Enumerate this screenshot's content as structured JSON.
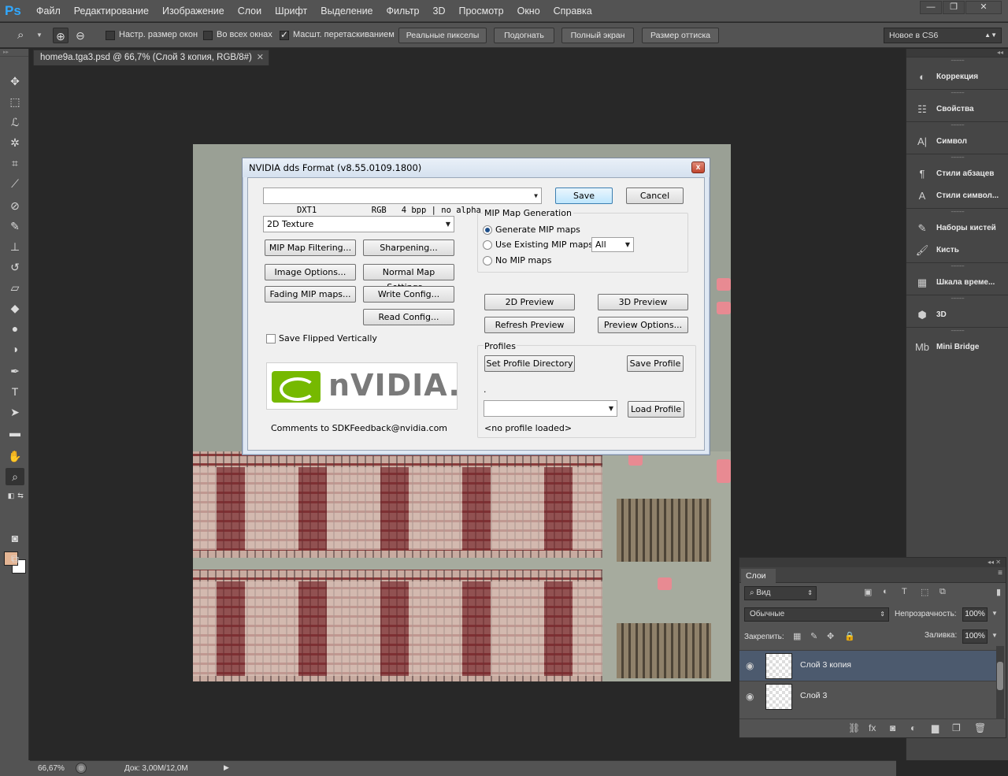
{
  "app": {
    "logo": "Ps",
    "menu": [
      "Файл",
      "Редактирование",
      "Изображение",
      "Слои",
      "Шрифт",
      "Выделение",
      "Фильтр",
      "3D",
      "Просмотр",
      "Окно",
      "Справка"
    ],
    "window_controls": {
      "minimize": "—",
      "restore": "❐",
      "close": "✕"
    }
  },
  "options_bar": {
    "resize_windows": {
      "label": "Настр. размер окон",
      "checked": false
    },
    "all_windows": {
      "label": "Во всех окнах",
      "checked": false
    },
    "scrubby_zoom": {
      "label": "Масшт. перетаскиванием",
      "checked": true
    },
    "buttons": [
      "Реальные пикселы",
      "Подогнать",
      "Полный экран",
      "Размер оттиска"
    ],
    "workspace": "Новое в CS6"
  },
  "document": {
    "tab_title": "home9a.tga3.psd @ 66,7% (Слой 3 копия, RGB/8#)",
    "tab_close": "✕"
  },
  "dialog": {
    "title": "NVIDIA dds Format (v8.55.0109.1800)",
    "close": "x",
    "format": "DXT1           RGB   4 bpp | no alpha",
    "save": "Save",
    "cancel": "Cancel",
    "texture_type": "2D Texture",
    "left_buttons": [
      "MIP Map Filtering...",
      "Sharpening...",
      "Image Options...",
      "Normal Map Settings...",
      "Fading MIP maps...",
      "Write Config...",
      "Read Config..."
    ],
    "save_flipped": {
      "label": "Save Flipped Vertically",
      "checked": false
    },
    "logo_word": "nVIDIA.",
    "feedback": "Comments to SDKFeedback@nvidia.com",
    "mip_group": {
      "title": "MIP Map Generation",
      "options": [
        "Generate MIP maps",
        "Use Existing MIP maps",
        "No MIP maps"
      ],
      "selected": "Generate MIP maps",
      "existing_count": "All"
    },
    "preview_buttons": [
      "2D Preview",
      "3D Preview",
      "Refresh Preview",
      "Preview Options..."
    ],
    "profiles": {
      "title": "Profiles",
      "set_dir": "Set Profile Directory",
      "save": "Save Profile",
      "dot": ".",
      "load": "Load Profile",
      "status": "<no profile loaded>"
    }
  },
  "dock": {
    "items": [
      "Коррекция",
      "Свойства",
      "Символ",
      "Стили абзацев",
      "Стили символ...",
      "Наборы кистей",
      "Кисть",
      "Шкала време...",
      "3D",
      "Mini Bridge"
    ],
    "icons": [
      "◐",
      "☷",
      "A|",
      "¶",
      "A",
      "✎",
      "🖌",
      "▦",
      "⬢",
      "Mb"
    ]
  },
  "layers_panel": {
    "tab": "Слои",
    "filter_kind": "⌕ Вид",
    "blend_mode": "Обычные",
    "opacity_label": "Непрозрачность:",
    "opacity": "100%",
    "lock_label": "Закрепить:",
    "fill_label": "Заливка:",
    "fill": "100%",
    "layers": [
      {
        "name": "Слой 3 копия",
        "selected": true
      },
      {
        "name": "Слой 3",
        "selected": false
      }
    ]
  },
  "status": {
    "zoom": "66,67%",
    "doc_info": "Док: 3,00M/12,0M"
  },
  "colors": {
    "foreground": "#e4b594",
    "background": "#ffffff",
    "accent": "#31a8ff",
    "nvidia_green": "#76b900"
  }
}
